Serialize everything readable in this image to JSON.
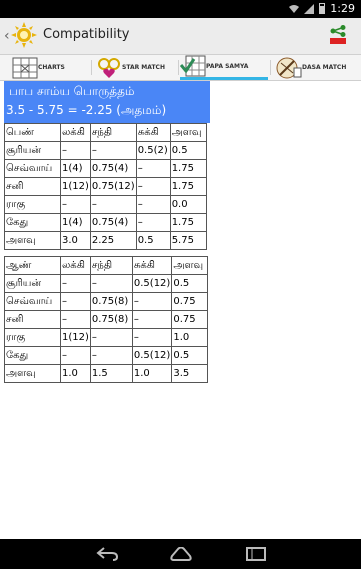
{
  "status": {
    "time": "1:29"
  },
  "actionbar": {
    "title": "Compatibility"
  },
  "tabs": [
    {
      "label": "CHARTS"
    },
    {
      "label": "STAR MATCH"
    },
    {
      "label": "PAPA SAMYA"
    },
    {
      "label": "DASA MATCH"
    }
  ],
  "header": {
    "title": "பாப சாம்ய பொருத்தம்",
    "result": "3.5 - 5.75 = -2.25 (அதமம்)"
  },
  "female": {
    "columns": [
      "பெண்",
      "லக்கி",
      "சந்தி",
      "சுக்கி",
      "அளவு"
    ],
    "rows": [
      [
        "சூரியன்",
        "–",
        "–",
        "0.5(2)",
        "0.5"
      ],
      [
        "செவ்வாய்",
        "1(4)",
        "0.75(4)",
        "–",
        "1.75"
      ],
      [
        "சனி",
        "1(12)",
        "0.75(12)",
        "–",
        "1.75"
      ],
      [
        "ராகு",
        "–",
        "–",
        "–",
        "0.0"
      ],
      [
        "கேது",
        "1(4)",
        "0.75(4)",
        "–",
        "1.75"
      ],
      [
        "அளவு",
        "3.0",
        "2.25",
        "0.5",
        "5.75"
      ]
    ]
  },
  "male": {
    "columns": [
      "ஆண்",
      "லக்கி",
      "சந்தி",
      "சுக்கி",
      "அளவு"
    ],
    "rows": [
      [
        "சூரியன்",
        "–",
        "–",
        "0.5(12)",
        "0.5"
      ],
      [
        "செவ்வாய்",
        "–",
        "0.75(8)",
        "–",
        "0.75"
      ],
      [
        "சனி",
        "–",
        "0.75(8)",
        "–",
        "0.75"
      ],
      [
        "ராகு",
        "1(12)",
        "–",
        "–",
        "1.0"
      ],
      [
        "கேது",
        "–",
        "–",
        "0.5(12)",
        "0.5"
      ],
      [
        "அளவு",
        "1.0",
        "1.5",
        "1.0",
        "3.5"
      ]
    ]
  }
}
